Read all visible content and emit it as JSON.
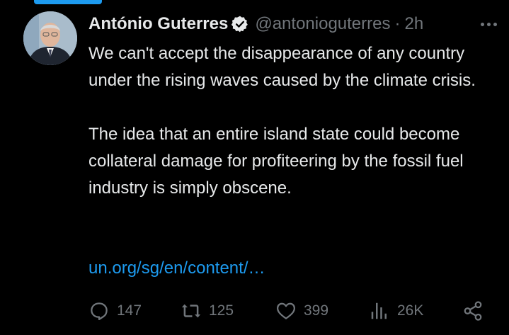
{
  "tweet": {
    "author": {
      "display_name": "António Guterres",
      "handle": "@antonioguterres",
      "verified": true,
      "avatar_icon": "profile-photo"
    },
    "separator": "·",
    "time": "2h",
    "paragraphs": [
      "We can't accept the disappearance of any country under the rising waves caused by the climate crisis.",
      "The idea that an entire island state could become collateral damage for profiteering by the fossil fuel industry is simply obscene."
    ],
    "link": "un.org/sg/en/content/…",
    "stats": {
      "replies": "147",
      "retweets": "125",
      "likes": "399",
      "views": "26K"
    }
  },
  "colors": {
    "background": "#000000",
    "text": "#e7e9ea",
    "secondary": "#71767b",
    "accent": "#1d9bf0"
  },
  "icons": {
    "reply": "reply-icon",
    "retweet": "retweet-icon",
    "like": "heart-icon",
    "views": "views-chart-icon",
    "share": "share-icon",
    "more": "more-icon",
    "verified": "verified-badge-icon"
  }
}
